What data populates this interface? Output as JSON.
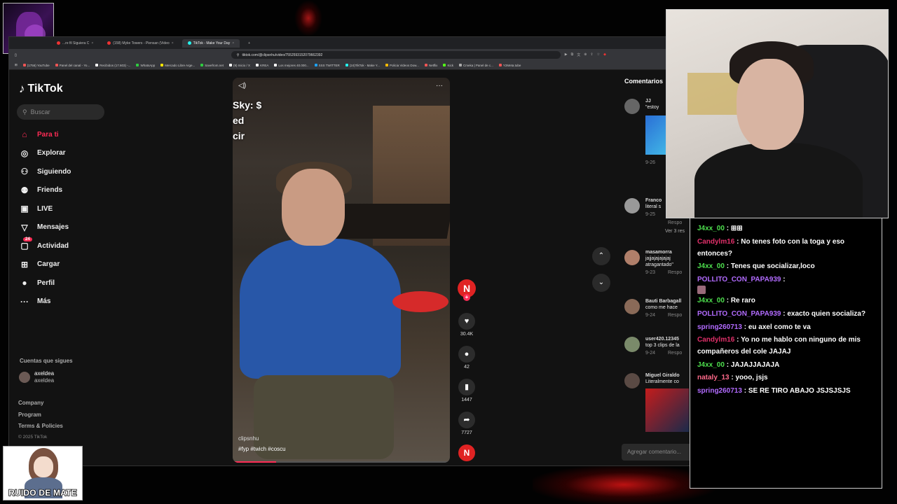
{
  "browser": {
    "tabs": [
      {
        "label": "...re fil Siguiera C",
        "active": false
      },
      {
        "label": "(158) Myke Towers - Piensan (Video",
        "active": false
      },
      {
        "label": "TikTok - Make Your Day",
        "active": true
      }
    ],
    "new_tab": "+",
    "url": "tiktok.com/@clipsnhu/video/7552593152079662392",
    "bookmarks": [
      "(1756) YouTube",
      "Panel del canal - Yo...",
      "Recibidos (17.603) -...",
      "WhatsApp",
      "Mercado Libre Arge...",
      "Savefrom.net",
      "(9) Inicio / X",
      "KREA",
      "Los mejores 40.000...",
      "SSS TWITTER",
      "(24)TikTok - Make Y...",
      "Policia Videos Dow...",
      "Netflix",
      "Kick",
      "Cmeka | Panel de c...",
      "Y2Meta.tube"
    ]
  },
  "sidebar": {
    "logo_text": "TikTok",
    "search_placeholder": "Buscar",
    "nav": [
      {
        "label": "Para ti",
        "icon": "home-icon",
        "active": true
      },
      {
        "label": "Explorar",
        "icon": "compass-icon"
      },
      {
        "label": "Siguiendo",
        "icon": "following-icon"
      },
      {
        "label": "Friends",
        "icon": "friends-icon"
      },
      {
        "label": "LIVE",
        "icon": "live-icon"
      },
      {
        "label": "Mensajes",
        "icon": "messages-icon"
      },
      {
        "label": "Actividad",
        "icon": "activity-icon",
        "badge": "24"
      },
      {
        "label": "Cargar",
        "icon": "upload-icon"
      },
      {
        "label": "Perfil",
        "icon": "profile-icon"
      },
      {
        "label": "Más",
        "icon": "more-icon"
      }
    ],
    "following_heading": "Cuentas que sigues",
    "following": [
      {
        "name": "axeldea",
        "handle": "axeldea"
      }
    ],
    "footer": [
      "Company",
      "Program",
      "Terms & Policies"
    ],
    "copyright": "© 2025 TikTok"
  },
  "video": {
    "overlay_lines": [
      "Sky: $",
      "ed",
      "cir"
    ],
    "author": "clipsnhu",
    "hashtags": "#fyp  #twich  #coscu",
    "progress": 0.2,
    "more": "···"
  },
  "actions": {
    "avatar_letter": "N",
    "likes": "30.4K",
    "comments": "42",
    "saves": "1447",
    "shares": "7727"
  },
  "comments": {
    "title": "Comentarios",
    "items": [
      {
        "name": "JJ",
        "text": "\"estoy",
        "date": "9-26"
      },
      {
        "name": "Franco",
        "text": "literal s",
        "date": "9-25",
        "reply": "Respo",
        "more": "Ver 3 res"
      },
      {
        "name": "masamorra",
        "text": "jajjajajajajaj",
        "text2": "atragantado\"",
        "date": "9-23",
        "reply": "Respo"
      },
      {
        "name": "Bauti Barbagall",
        "text": "como me hace",
        "date": "9-24",
        "reply": "Respo"
      },
      {
        "name": "user420.12345",
        "text": "top 3 clips de la",
        "date": "9-24",
        "reply": "Respo"
      },
      {
        "name": "Miguel Giraldo",
        "text": "Literalmente co"
      }
    ],
    "input_placeholder": "Agregar comentario..."
  },
  "chat": {
    "messages": [
      {
        "user": "J4xx_00",
        "color": "#4ee04e",
        "text": "⊞⊞"
      },
      {
        "user": "Candylm16",
        "color": "#e0306a",
        "text": "No tenes foto con la toga y eso entonces?"
      },
      {
        "user": "J4xx_00",
        "color": "#4ee04e",
        "text": "Tenes que socializar,loco"
      },
      {
        "user": "POLLITO_CON_PAPA939",
        "color": "#b26bff",
        "text": ""
      },
      {
        "user": "J4xx_00",
        "color": "#4ee04e",
        "text": "Re raro"
      },
      {
        "user": "POLLITO_CON_PAPA939",
        "color": "#b26bff",
        "text": "exacto quien socializa?"
      },
      {
        "user": "spring260713",
        "color": "#b26bff",
        "text": "eu axel como te va"
      },
      {
        "user": "Candylm16",
        "color": "#e0306a",
        "text": "Yo no me hablo con ninguno de mis compañeros del cole JAJAJ"
      },
      {
        "user": "J4xx_00",
        "color": "#4ee04e",
        "text": "JAJAJJAJAJA"
      },
      {
        "user": "nataly_13",
        "color": "#ff6a8a",
        "text": "yooo, jsjs"
      },
      {
        "user": "spring260713",
        "color": "#b26bff",
        "text": "SE RE TIRO ABAJO JSJSJSJS"
      }
    ]
  },
  "overlay": {
    "badge_text": "RUIDO DE MATE"
  },
  "colors": {
    "accent": "#fe2c55",
    "bg": "#121212"
  }
}
